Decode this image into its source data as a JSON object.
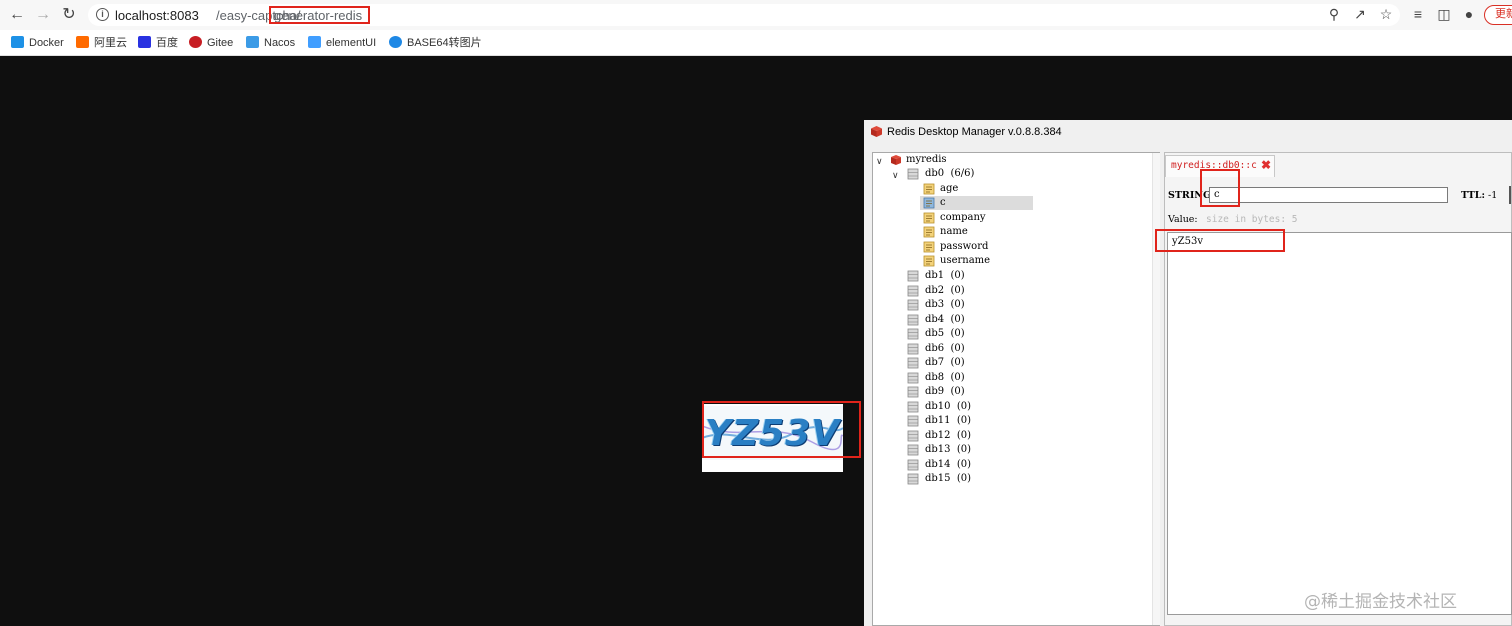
{
  "browser": {
    "url_host": "localhost:8083",
    "url_path_prefix": "/easy-captcha/",
    "url_path_highlight": "generator-redis",
    "update_label": "更新",
    "bookmarks": [
      {
        "label": "Docker",
        "icon": "docker-icon",
        "color": "#1d91e6"
      },
      {
        "label": "阿里云",
        "icon": "aliyun-icon",
        "color": "#ff6a00"
      },
      {
        "label": "百度",
        "icon": "baidu-icon",
        "color": "#2932e1"
      },
      {
        "label": "Gitee",
        "icon": "gitee-icon",
        "color": "#c71d23"
      },
      {
        "label": "Nacos",
        "icon": "nacos-icon",
        "color": "#3c9be6"
      },
      {
        "label": "elementUI",
        "icon": "element-icon",
        "color": "#409eff"
      },
      {
        "label": "BASE64转图片",
        "icon": "base64-icon",
        "color": "#1e88e5"
      }
    ]
  },
  "captcha": {
    "text": "YZ53V"
  },
  "rdm": {
    "title": "Redis Desktop Manager v.0.8.8.384",
    "connection": "myredis",
    "db0": {
      "label": "db0",
      "count": "(6/6)"
    },
    "keys": [
      "age",
      "c",
      "company",
      "name",
      "password",
      "username"
    ],
    "selected_key": "c",
    "other_dbs": [
      {
        "label": "db1",
        "count": "(0)"
      },
      {
        "label": "db2",
        "count": "(0)"
      },
      {
        "label": "db3",
        "count": "(0)"
      },
      {
        "label": "db4",
        "count": "(0)"
      },
      {
        "label": "db5",
        "count": "(0)"
      },
      {
        "label": "db6",
        "count": "(0)"
      },
      {
        "label": "db7",
        "count": "(0)"
      },
      {
        "label": "db8",
        "count": "(0)"
      },
      {
        "label": "db9",
        "count": "(0)"
      },
      {
        "label": "db10",
        "count": "(0)"
      },
      {
        "label": "db11",
        "count": "(0)"
      },
      {
        "label": "db12",
        "count": "(0)"
      },
      {
        "label": "db13",
        "count": "(0)"
      },
      {
        "label": "db14",
        "count": "(0)"
      },
      {
        "label": "db15",
        "count": "(0)"
      }
    ],
    "tab_label": "myredis::db0::c",
    "type_label": "STRING:",
    "key_name": "c",
    "ttl_label": "TTL:",
    "ttl_value": "-1",
    "value_label": "Value:",
    "value_size": "size in bytes: 5",
    "value": "yZ53v"
  },
  "watermark": "@稀土掘金技术社区"
}
